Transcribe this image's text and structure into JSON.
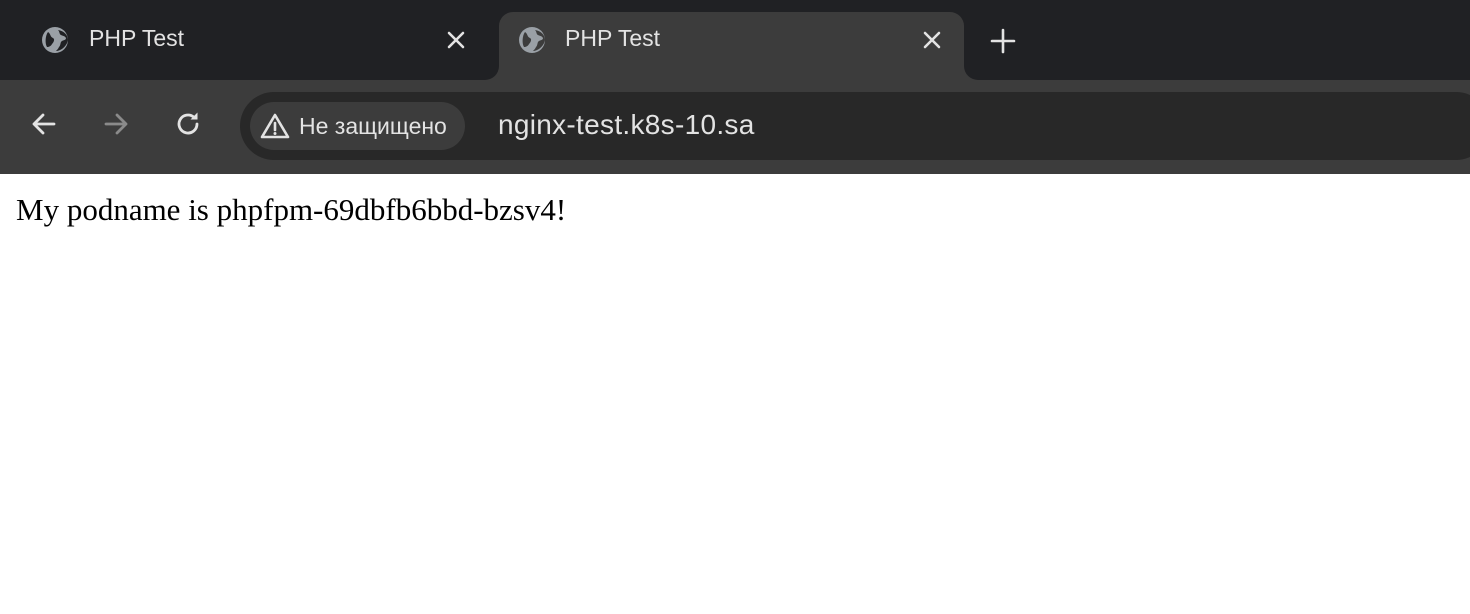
{
  "tabs": [
    {
      "title": "PHP Test",
      "active": false,
      "favicon": "globe-icon"
    },
    {
      "title": "PHP Test",
      "active": true,
      "favicon": "globe-icon"
    }
  ],
  "toolbar": {
    "back_icon": "arrow-left-icon",
    "forward_icon": "arrow-right-icon",
    "reload_icon": "reload-icon",
    "security_label": "Не защищено",
    "security_icon": "warning-triangle-icon",
    "url": "nginx-test.k8s-10.sa"
  },
  "page": {
    "body_text": "My podname is phpfpm-69dbfb6bbd-bzsv4!"
  },
  "colors": {
    "tabstrip_bg": "#202124",
    "toolbar_bg": "#3c3c3c",
    "omnibox_bg": "#282828",
    "text_light": "#e3e3e3",
    "icon_disabled": "#8a8a8a"
  }
}
